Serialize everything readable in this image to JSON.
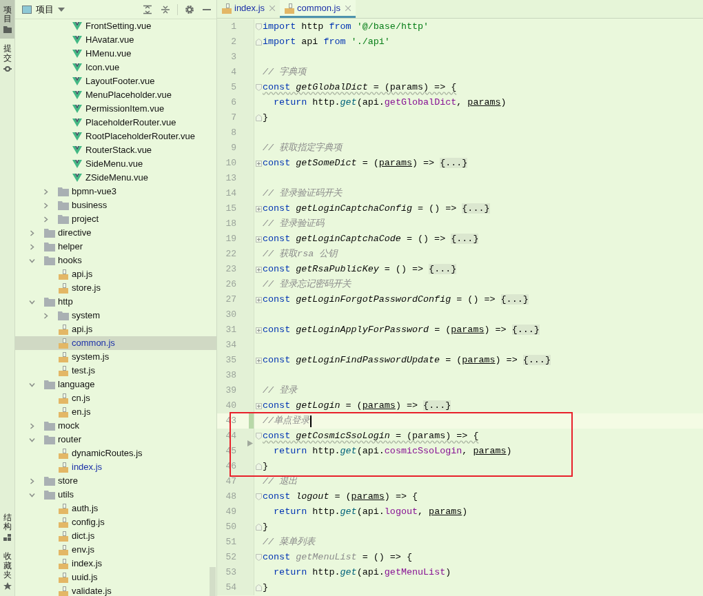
{
  "tool_strip": {
    "top": [
      {
        "label": "项目",
        "selected": true
      },
      {
        "label": "提交",
        "selected": false
      }
    ],
    "bottom": [
      {
        "label": "结构",
        "selected": false
      },
      {
        "label": "收藏夹",
        "selected": false
      }
    ]
  },
  "project_panel": {
    "title": "项目",
    "tree": [
      {
        "children": [
          {
            "children": [
              {
                "name": "FrontSetting.vue",
                "kind": "vue",
                "selected": false,
                "open": false
              },
              {
                "name": "HAvatar.vue",
                "kind": "vue",
                "selected": false,
                "open": false
              },
              {
                "name": "HMenu.vue",
                "kind": "vue",
                "selected": false,
                "open": false
              },
              {
                "name": "Icon.vue",
                "kind": "vue",
                "selected": false,
                "open": false
              },
              {
                "name": "LayoutFooter.vue",
                "kind": "vue",
                "selected": false,
                "open": false
              },
              {
                "name": "MenuPlaceholder.vue",
                "kind": "vue",
                "selected": false,
                "open": false
              },
              {
                "name": "PermissionItem.vue",
                "kind": "vue",
                "selected": false,
                "open": false
              },
              {
                "name": "PlaceholderRouter.vue",
                "kind": "vue",
                "selected": false,
                "open": false
              },
              {
                "name": "RootPlaceholderRouter.vue",
                "kind": "vue",
                "selected": false,
                "open": false
              },
              {
                "name": "RouterStack.vue",
                "kind": "vue",
                "selected": false,
                "open": false
              },
              {
                "name": "SideMenu.vue",
                "kind": "vue",
                "selected": false,
                "open": false
              },
              {
                "name": "ZSideMenu.vue",
                "kind": "vue",
                "selected": false,
                "open": false
              }
            ]
          },
          {
            "name": "bpmn-vue3",
            "kind": "folder",
            "expanded": false,
            "selected": false
          },
          {
            "name": "business",
            "kind": "folder",
            "expanded": false,
            "selected": false
          },
          {
            "name": "project",
            "kind": "folder",
            "expanded": false,
            "selected": false
          }
        ]
      },
      {
        "name": "directive",
        "kind": "folder",
        "expanded": false,
        "selected": false
      },
      {
        "name": "helper",
        "kind": "folder",
        "expanded": false,
        "selected": false
      },
      {
        "name": "hooks",
        "kind": "folder",
        "expanded": true,
        "selected": false,
        "children": [
          {
            "name": "api.js",
            "kind": "js",
            "selected": false,
            "open": false
          },
          {
            "name": "store.js",
            "kind": "js",
            "selected": false,
            "open": false
          }
        ]
      },
      {
        "name": "http",
        "kind": "folder",
        "expanded": true,
        "selected": false,
        "children": [
          {
            "name": "system",
            "kind": "folder",
            "expanded": false,
            "selected": false
          },
          {
            "name": "api.js",
            "kind": "js",
            "selected": false,
            "open": false
          },
          {
            "name": "common.js",
            "kind": "js",
            "selected": true,
            "open": true
          },
          {
            "name": "system.js",
            "kind": "js",
            "selected": false,
            "open": false
          },
          {
            "name": "test.js",
            "kind": "js",
            "selected": false,
            "open": false
          }
        ]
      },
      {
        "name": "language",
        "kind": "folder",
        "expanded": true,
        "selected": false,
        "children": [
          {
            "name": "cn.js",
            "kind": "js",
            "selected": false,
            "open": false
          },
          {
            "name": "en.js",
            "kind": "js",
            "selected": false,
            "open": false
          }
        ]
      },
      {
        "name": "mock",
        "kind": "folder",
        "expanded": false,
        "selected": false
      },
      {
        "name": "router",
        "kind": "folder",
        "expanded": true,
        "selected": false,
        "children": [
          {
            "name": "dynamicRoutes.js",
            "kind": "js",
            "selected": false,
            "open": false
          },
          {
            "name": "index.js",
            "kind": "js",
            "selected": false,
            "open": true
          }
        ]
      },
      {
        "name": "store",
        "kind": "folder",
        "expanded": false,
        "selected": false
      },
      {
        "name": "utils",
        "kind": "folder",
        "expanded": true,
        "selected": false,
        "children": [
          {
            "name": "auth.js",
            "kind": "js",
            "selected": false,
            "open": false
          },
          {
            "name": "config.js",
            "kind": "js",
            "selected": false,
            "open": false
          },
          {
            "name": "dict.js",
            "kind": "js",
            "selected": false,
            "open": false
          },
          {
            "name": "env.js",
            "kind": "js",
            "selected": false,
            "open": false
          },
          {
            "name": "index.js",
            "kind": "js",
            "selected": false,
            "open": false
          },
          {
            "name": "uuid.js",
            "kind": "js",
            "selected": false,
            "open": false
          },
          {
            "name": "validate.js",
            "kind": "js",
            "selected": false,
            "open": false
          }
        ]
      }
    ]
  },
  "editor": {
    "tabs": [
      {
        "label": "index.js",
        "selected": false
      },
      {
        "label": "common.js",
        "selected": true
      }
    ],
    "lines": [
      {
        "number": "1",
        "fold": {
          "kind": "start"
        },
        "tokens": [
          {
            "kind": "keyword",
            "text": "import"
          },
          {
            "kind": "text",
            "text": " http "
          },
          {
            "kind": "keyword",
            "text": "from"
          },
          {
            "kind": "string",
            "text": " '@/base/http'"
          }
        ]
      },
      {
        "number": "2",
        "fold": {
          "kind": "end"
        },
        "tokens": [
          {
            "kind": "keyword",
            "text": "import"
          },
          {
            "kind": "text",
            "text": " api "
          },
          {
            "kind": "keyword",
            "text": "from"
          },
          {
            "kind": "string",
            "text": " './api'"
          }
        ]
      },
      {
        "number": "3"
      },
      {
        "number": "4",
        "tokens": [
          {
            "kind": "comment",
            "text": "// 字典项"
          }
        ]
      },
      {
        "number": "5",
        "fold": {
          "kind": "start"
        },
        "warning": true,
        "tokens": [
          {
            "kind": "keyword",
            "text": "const"
          },
          {
            "kind": "decl",
            "text": " getGlobalDict"
          },
          {
            "kind": "text",
            "text": " = (params) => {"
          }
        ]
      },
      {
        "number": "6",
        "tokens": [
          {
            "kind": "keyword",
            "text": "  return"
          },
          {
            "kind": "text",
            "text": " http."
          },
          {
            "kind": "call",
            "text": "get"
          },
          {
            "kind": "text",
            "text": "(api."
          },
          {
            "kind": "prop",
            "text": "getGlobalDict"
          },
          {
            "kind": "text",
            "text": ", "
          },
          {
            "kind": "param",
            "text": "params"
          },
          {
            "kind": "text",
            "text": ")"
          }
        ]
      },
      {
        "number": "7",
        "fold": {
          "kind": "end"
        },
        "tokens": [
          {
            "kind": "text",
            "text": "}"
          }
        ]
      },
      {
        "number": "8"
      },
      {
        "number": "9",
        "tokens": [
          {
            "kind": "comment",
            "text": "// 获取指定字典项"
          }
        ]
      },
      {
        "number": "10",
        "fold": {
          "kind": "collapsed"
        },
        "tokens": [
          {
            "kind": "keyword",
            "text": "const"
          },
          {
            "kind": "decl",
            "text": " getSomeDict"
          },
          {
            "kind": "text",
            "text": " = ("
          },
          {
            "kind": "param",
            "text": "params"
          },
          {
            "kind": "text",
            "text": ") =>"
          },
          {
            "kind": "folded",
            "text": "{...}"
          }
        ]
      },
      {
        "number": "13"
      },
      {
        "number": "14",
        "tokens": [
          {
            "kind": "comment",
            "text": "// 登录验证码开关"
          }
        ]
      },
      {
        "number": "15",
        "fold": {
          "kind": "collapsed"
        },
        "tokens": [
          {
            "kind": "keyword",
            "text": "const"
          },
          {
            "kind": "decl",
            "text": " getLoginCaptchaConfig"
          },
          {
            "kind": "text",
            "text": " = () =>"
          },
          {
            "kind": "folded",
            "text": "{...}"
          }
        ]
      },
      {
        "number": "18",
        "tokens": [
          {
            "kind": "comment",
            "text": "// 登录验证码"
          }
        ]
      },
      {
        "number": "19",
        "fold": {
          "kind": "collapsed"
        },
        "tokens": [
          {
            "kind": "keyword",
            "text": "const"
          },
          {
            "kind": "decl",
            "text": " getLoginCaptchaCode"
          },
          {
            "kind": "text",
            "text": " = () =>"
          },
          {
            "kind": "folded",
            "text": "{...}"
          }
        ]
      },
      {
        "number": "22",
        "tokens": [
          {
            "kind": "comment",
            "text": "// 获取rsa 公钥"
          }
        ]
      },
      {
        "number": "23",
        "fold": {
          "kind": "collapsed"
        },
        "tokens": [
          {
            "kind": "keyword",
            "text": "const"
          },
          {
            "kind": "decl",
            "text": " getRsaPublicKey"
          },
          {
            "kind": "text",
            "text": " = () =>"
          },
          {
            "kind": "folded",
            "text": "{...}"
          }
        ]
      },
      {
        "number": "26",
        "tokens": [
          {
            "kind": "comment",
            "text": "// 登录忘记密码开关"
          }
        ]
      },
      {
        "number": "27",
        "fold": {
          "kind": "collapsed"
        },
        "tokens": [
          {
            "kind": "keyword",
            "text": "const"
          },
          {
            "kind": "decl",
            "text": " getLoginForgotPasswordConfig"
          },
          {
            "kind": "text",
            "text": " = () =>"
          },
          {
            "kind": "folded",
            "text": "{...}"
          }
        ]
      },
      {
        "number": "30"
      },
      {
        "number": "31",
        "fold": {
          "kind": "collapsed"
        },
        "tokens": [
          {
            "kind": "keyword",
            "text": "const"
          },
          {
            "kind": "decl",
            "text": " getLoginApplyForPassword"
          },
          {
            "kind": "text",
            "text": " = ("
          },
          {
            "kind": "param",
            "text": "params"
          },
          {
            "kind": "text",
            "text": ") =>"
          },
          {
            "kind": "folded",
            "text": "{...}"
          }
        ]
      },
      {
        "number": "34"
      },
      {
        "number": "35",
        "fold": {
          "kind": "collapsed"
        },
        "tokens": [
          {
            "kind": "keyword",
            "text": "const"
          },
          {
            "kind": "decl",
            "text": " getLoginFindPasswordUpdate"
          },
          {
            "kind": "text",
            "text": " = ("
          },
          {
            "kind": "param",
            "text": "params"
          },
          {
            "kind": "text",
            "text": ") =>"
          },
          {
            "kind": "folded",
            "text": "{...}"
          }
        ]
      },
      {
        "number": "38"
      },
      {
        "number": "39",
        "tokens": [
          {
            "kind": "comment",
            "text": "// 登录"
          }
        ]
      },
      {
        "number": "40",
        "fold": {
          "kind": "collapsed"
        },
        "tokens": [
          {
            "kind": "keyword",
            "text": "const"
          },
          {
            "kind": "decl",
            "text": " getLogin"
          },
          {
            "kind": "text",
            "text": " = ("
          },
          {
            "kind": "param",
            "text": "params"
          },
          {
            "kind": "text",
            "text": ") =>"
          },
          {
            "kind": "folded",
            "text": "{...}"
          }
        ]
      },
      {
        "number": "43",
        "current": true,
        "changed": true,
        "boxed": true,
        "tokens": [
          {
            "kind": "comment",
            "text": "//单点登录"
          }
        ]
      },
      {
        "number": "44",
        "fold": {
          "kind": "start"
        },
        "warning": true,
        "boxed": true,
        "marker": true,
        "tokens": [
          {
            "kind": "keyword",
            "text": "const"
          },
          {
            "kind": "decl",
            "text": " getCosmicSsoLogin"
          },
          {
            "kind": "text",
            "text": " = (params) => {"
          }
        ]
      },
      {
        "number": "45",
        "boxed": true,
        "tokens": [
          {
            "kind": "keyword",
            "text": "  return"
          },
          {
            "kind": "text",
            "text": " http."
          },
          {
            "kind": "call",
            "text": "get"
          },
          {
            "kind": "text",
            "text": "(api."
          },
          {
            "kind": "prop",
            "text": "cosmicSsoLogin"
          },
          {
            "kind": "text",
            "text": ", "
          },
          {
            "kind": "param",
            "text": "params"
          },
          {
            "kind": "text",
            "text": ")"
          }
        ]
      },
      {
        "number": "46",
        "fold": {
          "kind": "end"
        },
        "boxed": true,
        "tokens": [
          {
            "kind": "text",
            "text": "}"
          }
        ]
      },
      {
        "number": "47",
        "tokens": [
          {
            "kind": "comment",
            "text": "// 退出"
          }
        ]
      },
      {
        "number": "48",
        "fold": {
          "kind": "start"
        },
        "tokens": [
          {
            "kind": "keyword",
            "text": "const"
          },
          {
            "kind": "decl",
            "text": " logout"
          },
          {
            "kind": "text",
            "text": " = ("
          },
          {
            "kind": "param",
            "text": "params"
          },
          {
            "kind": "text",
            "text": ") => {"
          }
        ]
      },
      {
        "number": "49",
        "tokens": [
          {
            "kind": "keyword",
            "text": "  return"
          },
          {
            "kind": "text",
            "text": " http."
          },
          {
            "kind": "call",
            "text": "get"
          },
          {
            "kind": "text",
            "text": "(api."
          },
          {
            "kind": "prop",
            "text": "logout"
          },
          {
            "kind": "text",
            "text": ", "
          },
          {
            "kind": "param",
            "text": "params"
          },
          {
            "kind": "text",
            "text": ")"
          }
        ]
      },
      {
        "number": "50",
        "fold": {
          "kind": "end"
        },
        "tokens": [
          {
            "kind": "text",
            "text": "}"
          }
        ]
      },
      {
        "number": "51",
        "tokens": [
          {
            "kind": "comment",
            "text": "// 菜单列表"
          }
        ]
      },
      {
        "number": "52",
        "fold": {
          "kind": "start"
        },
        "tokens": [
          {
            "kind": "keyword",
            "text": "const"
          },
          {
            "kind": "unused",
            "text": " getMenuList"
          },
          {
            "kind": "text",
            "text": " = () => {"
          }
        ]
      },
      {
        "number": "53",
        "tokens": [
          {
            "kind": "keyword",
            "text": "  return"
          },
          {
            "kind": "text",
            "text": " http."
          },
          {
            "kind": "call",
            "text": "get"
          },
          {
            "kind": "text",
            "text": "(api."
          },
          {
            "kind": "prop",
            "text": "getMenuList"
          },
          {
            "kind": "text",
            "text": ")"
          }
        ]
      },
      {
        "number": "54",
        "fold": {
          "kind": "end"
        },
        "tokens": [
          {
            "kind": "text",
            "text": "}"
          }
        ]
      }
    ]
  }
}
